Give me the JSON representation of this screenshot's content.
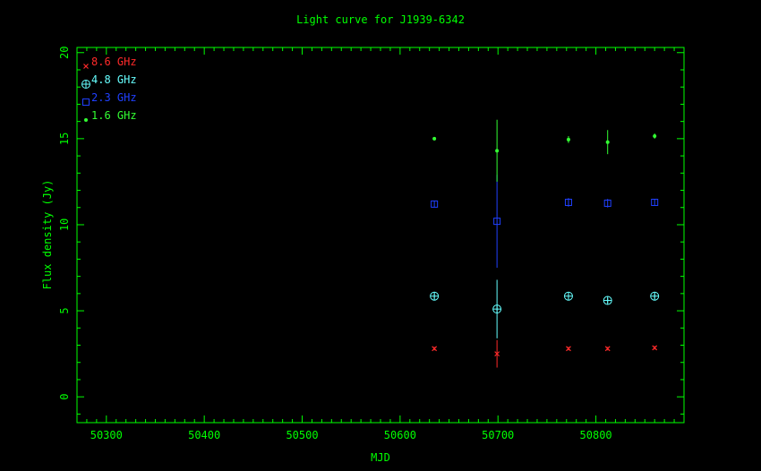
{
  "chart_data": {
    "type": "scatter",
    "title": "Light curve for J1939-6342",
    "xlabel": "MJD",
    "ylabel": "Flux density (Jy)",
    "xlim": [
      50270,
      50890
    ],
    "ylim": [
      -1.5,
      20.3
    ],
    "xticks": [
      50300,
      50400,
      50500,
      50600,
      50700,
      50800
    ],
    "yticks": [
      0,
      5,
      10,
      15,
      20
    ],
    "grid": false,
    "legend_position": "top-left",
    "axis_color": "#00ff00",
    "background": "#000000",
    "series": [
      {
        "name": "8.6 GHz",
        "marker": "cross",
        "color": "#ff2a2a",
        "points": [
          {
            "x": 50635,
            "y": 2.8,
            "err": 0.1
          },
          {
            "x": 50699,
            "y": 2.5,
            "err": 0.8
          },
          {
            "x": 50772,
            "y": 2.8,
            "err": 0.1
          },
          {
            "x": 50812,
            "y": 2.8,
            "err": 0.1
          },
          {
            "x": 50860,
            "y": 2.85,
            "err": 0.1
          }
        ]
      },
      {
        "name": "4.8 GHz",
        "marker": "circle-plus",
        "color": "#66ffff",
        "points": [
          {
            "x": 50635,
            "y": 5.85,
            "err": 0.15
          },
          {
            "x": 50699,
            "y": 5.1,
            "err": 1.7
          },
          {
            "x": 50772,
            "y": 5.85,
            "err": 0.15
          },
          {
            "x": 50812,
            "y": 5.6,
            "err": 0.15
          },
          {
            "x": 50860,
            "y": 5.85,
            "err": 0.15
          }
        ]
      },
      {
        "name": "2.3 GHz",
        "marker": "square",
        "color": "#2040ff",
        "points": [
          {
            "x": 50635,
            "y": 11.2,
            "err": 0.2
          },
          {
            "x": 50699,
            "y": 10.2,
            "err": 2.7
          },
          {
            "x": 50772,
            "y": 11.3,
            "err": 0.25
          },
          {
            "x": 50812,
            "y": 11.25,
            "err": 0.25
          },
          {
            "x": 50860,
            "y": 11.3,
            "err": 0.2
          }
        ]
      },
      {
        "name": "1.6 GHz",
        "marker": "dot",
        "color": "#33ff33",
        "points": [
          {
            "x": 50635,
            "y": 15.0,
            "err": 0.1
          },
          {
            "x": 50699,
            "y": 14.3,
            "err": 1.8
          },
          {
            "x": 50772,
            "y": 14.95,
            "err": 0.2
          },
          {
            "x": 50812,
            "y": 14.8,
            "err": 0.7
          },
          {
            "x": 50860,
            "y": 15.15,
            "err": 0.15
          }
        ]
      }
    ]
  }
}
